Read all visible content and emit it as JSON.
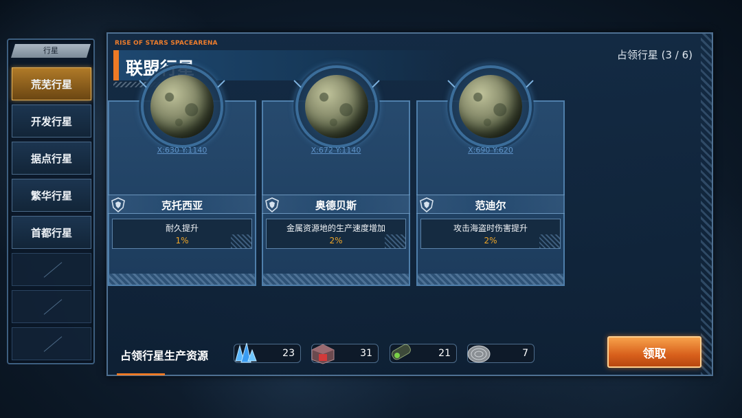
{
  "sidebar": {
    "header": "行星",
    "items": [
      {
        "label": "荒芜行星",
        "active": true
      },
      {
        "label": "开发行星",
        "active": false
      },
      {
        "label": "据点行星",
        "active": false
      },
      {
        "label": "繁华行星",
        "active": false
      },
      {
        "label": "首都行星",
        "active": false
      }
    ],
    "empty_slots": 3
  },
  "panel": {
    "brand": "RISE OF STARS SPACEARENA",
    "title": "联盟行星",
    "occupied_label": "占领行星 (3 / 6)"
  },
  "planets": [
    {
      "coords": "X:630 Y:1140",
      "name": "克托西亚",
      "bonus_label": "耐久提升",
      "bonus_value": "1%"
    },
    {
      "coords": "X:672 Y:1140",
      "name": "奥德贝斯",
      "bonus_label": "金属资源地的生产速度增加",
      "bonus_value": "2%"
    },
    {
      "coords": "X:690 Y:620",
      "name": "范迪尔",
      "bonus_label": "攻击海盗时伤害提升",
      "bonus_value": "2%"
    }
  ],
  "resources": {
    "title": "占领行星生产资源",
    "items": [
      {
        "icon": "crystal-icon",
        "value": "23"
      },
      {
        "icon": "metal-icon",
        "value": "31"
      },
      {
        "icon": "fuel-icon",
        "value": "21"
      },
      {
        "icon": "mineral-icon",
        "value": "7"
      }
    ]
  },
  "claim_button": "领取",
  "colors": {
    "accent_orange": "#ee7a25",
    "bonus_value": "#f0a628",
    "active_tab": "#b07a28",
    "panel_border": "#4f7193"
  }
}
